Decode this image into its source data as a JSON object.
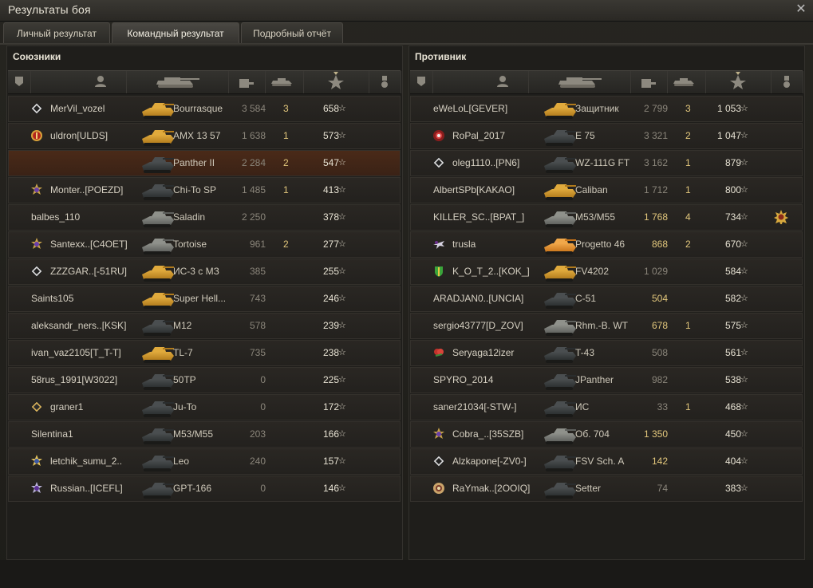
{
  "window": {
    "title": "Результаты боя"
  },
  "tabs": [
    "Личный результат",
    "Командный результат",
    "Подробный отчёт"
  ],
  "allies": {
    "title": "Союзники",
    "rows": [
      {
        "player": "MerVil_vozel",
        "badge": "diamond",
        "vehicle": "Bourrasque",
        "tank": "gold",
        "damage": "3 584",
        "damage_hi": false,
        "kills": "3",
        "xp": "658"
      },
      {
        "player": "uldron[ULDS]",
        "badge": "round-red",
        "vehicle": "AMX 13 57",
        "tank": "gold",
        "damage": "1 638",
        "damage_hi": false,
        "kills": "1",
        "xp": "573"
      },
      {
        "player": "",
        "badge": "none",
        "vehicle": "Panther II",
        "tank": "dark",
        "damage": "2 284",
        "damage_hi": false,
        "kills": "2",
        "xp": "547",
        "self": true
      },
      {
        "player": "Monter..[POEZD]",
        "badge": "star-purple",
        "vehicle": "Chi-To SP",
        "tank": "dark",
        "damage": "1 485",
        "damage_hi": false,
        "kills": "1",
        "xp": "413"
      },
      {
        "player": "balbes_110",
        "badge": "none",
        "vehicle": "Saladin",
        "tank": "grey",
        "damage": "2 250",
        "damage_hi": false,
        "kills": "",
        "xp": "378"
      },
      {
        "player": "Santexx..[C4OET]",
        "badge": "star-purple",
        "vehicle": "Tortoise",
        "tank": "grey",
        "damage": "961",
        "damage_hi": false,
        "kills": "2",
        "xp": "277"
      },
      {
        "player": "ZZZGAR..[-51RU]",
        "badge": "diamond",
        "vehicle": "ИС-3 с МЗ",
        "tank": "gold",
        "damage": "385",
        "damage_hi": false,
        "kills": "",
        "xp": "255"
      },
      {
        "player": "Saints105",
        "badge": "none",
        "vehicle": "Super Hell...",
        "tank": "gold",
        "damage": "743",
        "damage_hi": false,
        "kills": "",
        "xp": "246"
      },
      {
        "player": "aleksandr_ners..[KSK]",
        "badge": "none",
        "vehicle": "M12",
        "tank": "dark",
        "damage": "578",
        "damage_hi": false,
        "kills": "",
        "xp": "239"
      },
      {
        "player": "ivan_vaz2105[T_T-T]",
        "badge": "none",
        "vehicle": "TL-7",
        "tank": "gold",
        "damage": "735",
        "damage_hi": false,
        "kills": "",
        "xp": "238"
      },
      {
        "player": "58rus_1991[W3022]",
        "badge": "none",
        "vehicle": "50TP",
        "tank": "dark",
        "damage": "0",
        "damage_hi": false,
        "kills": "",
        "xp": "225"
      },
      {
        "player": "graner1",
        "badge": "diamond-gold",
        "vehicle": "Ju-To",
        "tank": "dark",
        "damage": "0",
        "damage_hi": false,
        "kills": "",
        "xp": "172"
      },
      {
        "player": "Silentina1",
        "badge": "none",
        "vehicle": "M53/M55",
        "tank": "dark",
        "damage": "203",
        "damage_hi": false,
        "kills": "",
        "xp": "166"
      },
      {
        "player": "letchik_sumu_2..",
        "badge": "star-gold",
        "vehicle": "Leo",
        "tank": "dark",
        "damage": "240",
        "damage_hi": false,
        "kills": "",
        "xp": "157"
      },
      {
        "player": "Russian..[ICEFL]",
        "badge": "star-purple2",
        "vehicle": "GPT-166",
        "tank": "dark",
        "damage": "0",
        "damage_hi": false,
        "kills": "",
        "xp": "146"
      }
    ]
  },
  "enemies": {
    "title": "Противник",
    "rows": [
      {
        "player": "eWeLoL[GEVER]",
        "badge": "none",
        "vehicle": "Защитник",
        "tank": "gold",
        "damage": "2 799",
        "damage_hi": false,
        "kills": "3",
        "xp": "1 053"
      },
      {
        "player": "RoPal_2017",
        "badge": "round-red2",
        "vehicle": "E 75",
        "tank": "dark",
        "damage": "3 321",
        "damage_hi": false,
        "kills": "2",
        "xp": "1 047"
      },
      {
        "player": "oleg1110..[PN6]",
        "badge": "diamond",
        "vehicle": "WZ-111G FT",
        "tank": "dark",
        "damage": "3 162",
        "damage_hi": false,
        "kills": "1",
        "xp": "879"
      },
      {
        "player": "AlbertSPb[KAKAO]",
        "badge": "none",
        "vehicle": "Caliban",
        "tank": "gold",
        "damage": "1 712",
        "damage_hi": false,
        "kills": "1",
        "xp": "800"
      },
      {
        "player": "KILLER_SC..[BPAT_]",
        "badge": "none",
        "vehicle": "M53/M55",
        "tank": "grey",
        "damage": "1 768",
        "damage_hi": true,
        "kills": "4",
        "xp": "734",
        "medal": true
      },
      {
        "player": "trusla",
        "badge": "plane",
        "vehicle": "Progetto 46",
        "tank": "orange",
        "damage": "868",
        "damage_hi": true,
        "kills": "2",
        "xp": "670"
      },
      {
        "player": "K_O_T_2..[KOK_]",
        "badge": "shield-green",
        "vehicle": "FV4202",
        "tank": "gold",
        "damage": "1 029",
        "damage_hi": false,
        "kills": "",
        "xp": "584"
      },
      {
        "player": "ARADJAN0..[UNCIA]",
        "badge": "none",
        "vehicle": "C-51",
        "tank": "dark",
        "damage": "504",
        "damage_hi": true,
        "kills": "",
        "xp": "582"
      },
      {
        "player": "sergio43777[D_ZOV]",
        "badge": "none",
        "vehicle": "Rhm.-B. WT",
        "tank": "grey",
        "damage": "678",
        "damage_hi": true,
        "kills": "1",
        "xp": "575"
      },
      {
        "player": "Seryaga12izer",
        "badge": "flower",
        "vehicle": "T-43",
        "tank": "dark",
        "damage": "508",
        "damage_hi": false,
        "kills": "",
        "xp": "561"
      },
      {
        "player": "SPYRO_2014",
        "badge": "none",
        "vehicle": "JPanther",
        "tank": "dark",
        "damage": "982",
        "damage_hi": false,
        "kills": "",
        "xp": "538"
      },
      {
        "player": "saner21034[-STW-]",
        "badge": "none",
        "vehicle": "ИС",
        "tank": "dark",
        "damage": "33",
        "damage_hi": false,
        "kills": "1",
        "xp": "468"
      },
      {
        "player": "Cobra_..[35SZB]",
        "badge": "star-purple",
        "vehicle": "Об. 704",
        "tank": "grey",
        "damage": "1 350",
        "damage_hi": true,
        "kills": "",
        "xp": "450"
      },
      {
        "player": "Alzkapone[-ZV0-]",
        "badge": "diamond",
        "vehicle": "FSV Sch. A",
        "tank": "dark",
        "damage": "142",
        "damage_hi": true,
        "kills": "",
        "xp": "404"
      },
      {
        "player": "RaYmak..[2OOIQ]",
        "badge": "medal-round",
        "vehicle": "Setter",
        "tank": "dark",
        "damage": "74",
        "damage_hi": false,
        "kills": "",
        "xp": "383"
      }
    ]
  },
  "star_glyph": "☆"
}
